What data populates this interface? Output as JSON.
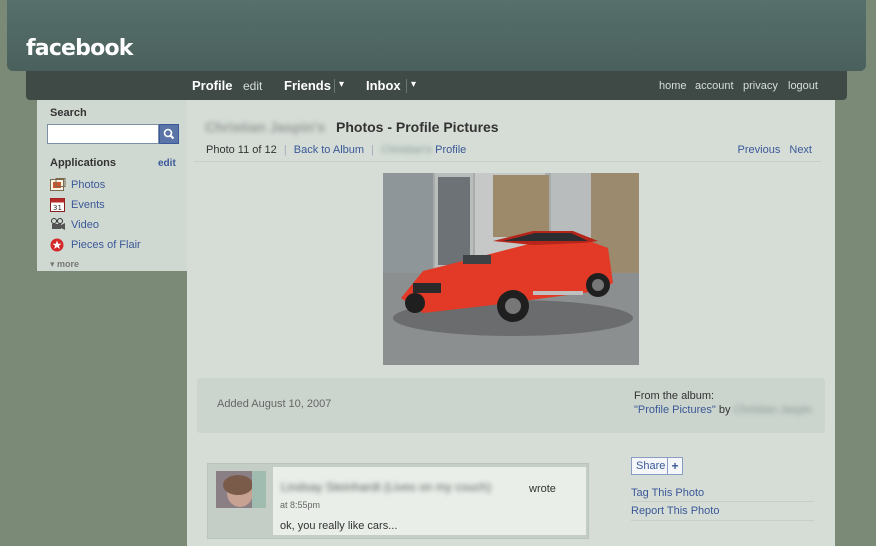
{
  "header": {
    "logo": "facebook"
  },
  "nav": {
    "profile": "Profile",
    "edit": "edit",
    "friends": "Friends",
    "inbox": "Inbox",
    "dropdown_glyph": "▾",
    "right": [
      "home",
      "account",
      "privacy",
      "logout"
    ]
  },
  "sidebar": {
    "search_label": "Search",
    "search_value": "",
    "search_icon": "magnifier-icon",
    "applications_label": "Applications",
    "applications_edit": "edit",
    "apps": [
      {
        "label": "Photos",
        "icon": "photos-icon"
      },
      {
        "label": "Events",
        "icon": "calendar-icon",
        "icon_text": "31"
      },
      {
        "label": "Video",
        "icon": "video-camera-icon"
      },
      {
        "label": "Pieces of Flair",
        "icon": "flair-star-icon"
      }
    ],
    "more": "more",
    "more_glyph": "▾"
  },
  "main": {
    "owner_name": "Christian Jaspin's",
    "title": "Photos - Profile Pictures",
    "photo_counter": "Photo 11 of 12",
    "back_to_album": "Back to Album",
    "owner_short": "Christian's",
    "profile_link": "Profile",
    "separator": "|",
    "previous": "Previous",
    "next": "Next",
    "photo_alt": "red muscle car",
    "added": "Added August 10, 2007",
    "from_album": "From the album:",
    "album_name": "\"Profile Pictures\"",
    "by": "by",
    "album_owner": "Christian Jaspin"
  },
  "comment": {
    "author": "Lindsay Steinhardt (Lives on my couch)",
    "wrote": "wrote",
    "time": "at 8:55pm",
    "text": "ok, you really like cars..."
  },
  "actions": {
    "share": "Share",
    "share_plus": "+",
    "tag": "Tag This Photo",
    "report": "Report This Photo"
  },
  "colors": {
    "link": "#3b5998",
    "header": "#4f6662",
    "nav": "#3f4a46",
    "page_bg": "#7a8a76",
    "content_bg": "#d5ddd6"
  }
}
